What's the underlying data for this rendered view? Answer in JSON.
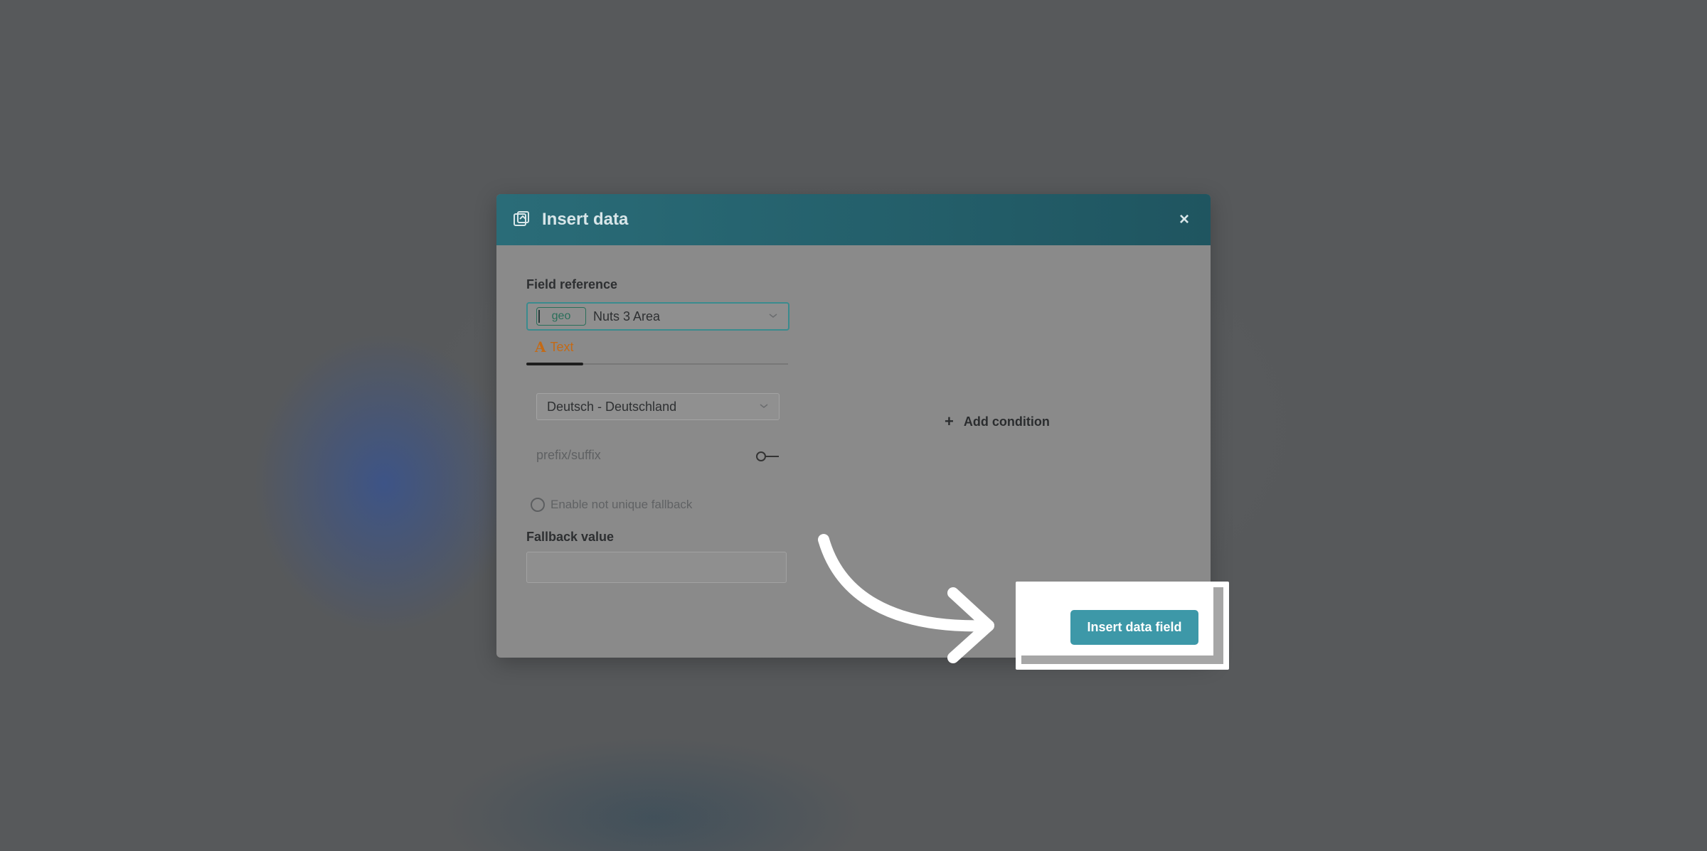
{
  "modal": {
    "title": "Insert data",
    "close_glyph": "×",
    "icon": "insert-data-icon"
  },
  "field_reference": {
    "label": "Field reference",
    "tag": "geo",
    "value": "Nuts 3 Area"
  },
  "tabs": [
    {
      "label": "Text",
      "icon": "A"
    }
  ],
  "language_select": {
    "value": "Deutsch - Deutschland"
  },
  "prefix_suffix": {
    "label": "prefix/suffix",
    "enabled": false
  },
  "fallback_not_unique": {
    "label": "Enable not unique fallback",
    "checked": false
  },
  "fallback_value": {
    "label": "Fallback value",
    "value": ""
  },
  "conditions": {
    "add_label": "Add condition",
    "add_glyph": "+"
  },
  "actions": {
    "insert_label": "Insert data field"
  },
  "colors": {
    "header": "#1f5560",
    "accent_tab": "#c46a16",
    "primary_button": "#3d98a8"
  }
}
